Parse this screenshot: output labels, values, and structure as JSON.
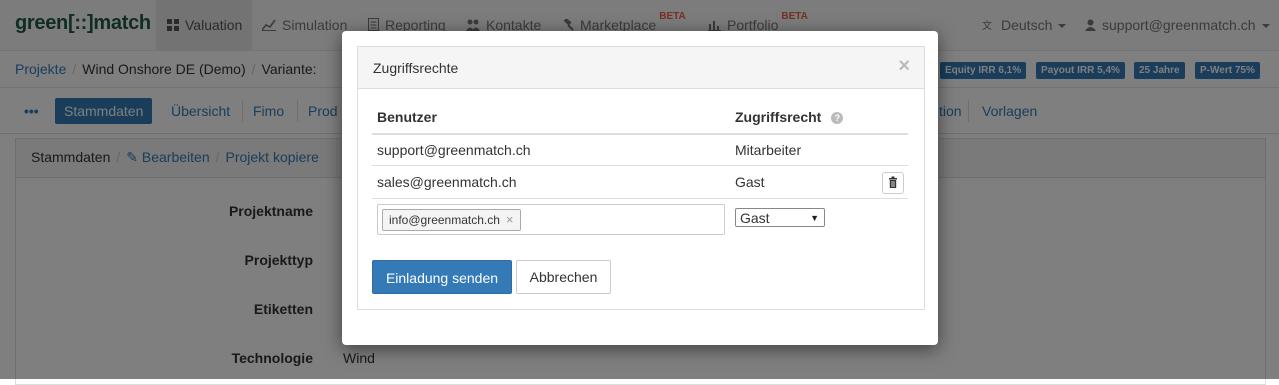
{
  "navbar": {
    "brand": "green[::]match",
    "items": [
      {
        "label": "Valuation",
        "icon": "grid-icon"
      },
      {
        "label": "Simulation",
        "icon": "line-chart-icon"
      },
      {
        "label": "Reporting",
        "icon": "document-icon"
      },
      {
        "label": "Kontakte",
        "icon": "users-icon"
      },
      {
        "label": "Marketplace",
        "icon": "gavel-icon",
        "badge": "BETA"
      },
      {
        "label": "Portfolio",
        "icon": "bar-chart-icon",
        "badge": "BETA"
      }
    ],
    "language": "Deutsch",
    "user": "support@greenmatch.ch"
  },
  "breadcrumb": {
    "items": [
      "Projekte",
      "Wind Onshore DE (Demo)",
      "Variante:"
    ]
  },
  "kpi_badges": [
    "Equity IRR 6,1%",
    "Payout IRR 5,4%",
    "25 Jahre",
    "P-Wert 75%"
  ],
  "tabs": {
    "more": "•••",
    "items": [
      "Stammdaten",
      "Übersicht",
      "Fimo",
      "Prod",
      "tion",
      "Vorlagen"
    ]
  },
  "panel": {
    "crumbs": [
      "Stammdaten",
      "Bearbeiten",
      "Projekt kopiere"
    ],
    "fields": [
      {
        "label": "Projektname",
        "value": ""
      },
      {
        "label": "Projekttyp",
        "value": ""
      },
      {
        "label": "Etiketten",
        "value": ""
      },
      {
        "label": "Technologie",
        "value": "Wind"
      }
    ]
  },
  "modal": {
    "title": "Zugriffsrechte",
    "close": "×",
    "headers": {
      "user": "Benutzer",
      "access": "Zugriffsrecht",
      "help": "?"
    },
    "rows": [
      {
        "user": "support@greenmatch.ch",
        "access": "Mitarbeiter"
      },
      {
        "user": "sales@greenmatch.ch",
        "access": "Gast"
      }
    ],
    "new_invite": {
      "tag": "info@greenmatch.ch",
      "tag_remove": "×",
      "role": "Gast"
    },
    "buttons": {
      "send": "Einladung senden",
      "cancel": "Abbrechen"
    }
  }
}
